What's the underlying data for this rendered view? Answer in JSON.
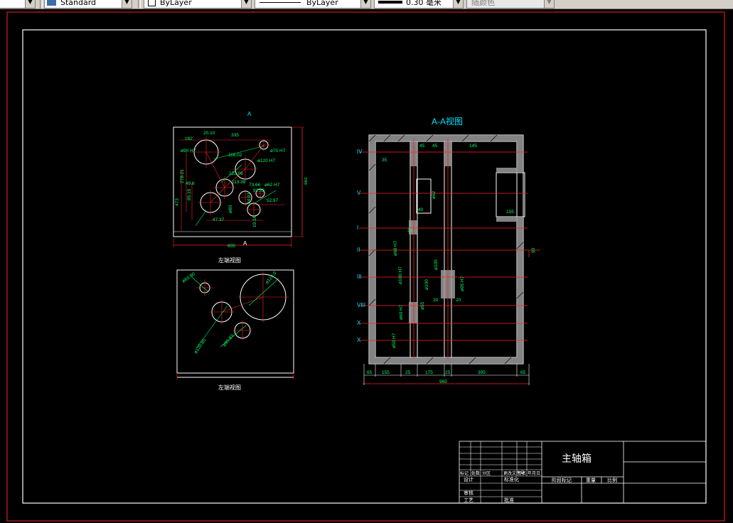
{
  "toolbar": {
    "style_value": "Standard",
    "layer_value": "ByLayer",
    "linetype_value": "ByLayer",
    "lineweight_value": "0.30 毫米",
    "plotstyle_value": "随颜色"
  },
  "drawing": {
    "section_title": "A-A视图",
    "left_end_view_label": "左端视图",
    "right_end_view_label": "左端视图",
    "section_marker": "A",
    "roman_labels": [
      "IV",
      "V",
      "I",
      "II",
      "III",
      "VIII",
      "X",
      "X"
    ],
    "top_view_dims": [
      "182",
      "20.10",
      "335",
      "116.02",
      "123.06",
      "278.21",
      "473",
      "49.6",
      "85.15",
      "47.37",
      "661",
      "605",
      "113.36",
      "92.55",
      "73.66",
      "52.97",
      "24.91",
      "19.16"
    ],
    "bottom_dims": [
      "65",
      "155",
      "25",
      "175",
      "25",
      "395",
      "65",
      "965"
    ],
    "section_dims": [
      "45",
      "45",
      "35",
      "40",
      "155",
      "90",
      "35",
      "20",
      "20",
      "145"
    ],
    "diameter_labels": [
      "ø90 H7",
      "ø120 H7",
      "ø70 H7",
      "ø80",
      "ø62 H7",
      "ø100 H7",
      "ø95 H7",
      "ø55",
      "ø50 H7",
      "ø68 H7",
      "ø62",
      "ø100",
      "ø105",
      "ø60 H7"
    ],
    "bottom_view_diams": [
      "ø60.80",
      "ø124.0",
      "ø120.85",
      "ø95.83"
    ]
  },
  "title_block": {
    "part_name": "主轴箱",
    "row_headers": [
      "标记",
      "处数",
      "分区",
      "更改文件号",
      "签名",
      "年月日"
    ],
    "design_label": "设计",
    "standardize_label": "标准化",
    "stage_label": "阶段标记",
    "weight_label": "重量",
    "scale_label": "比例",
    "review_label": "审核",
    "process_label": "工艺",
    "approve_label": "批准"
  }
}
